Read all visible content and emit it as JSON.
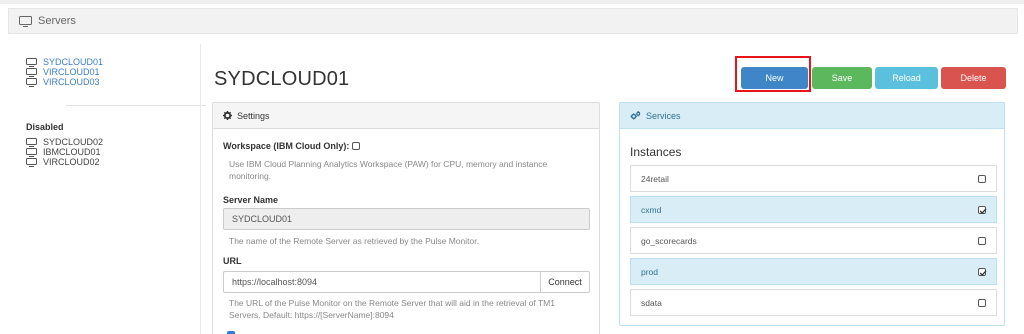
{
  "header": {
    "title": "Servers"
  },
  "sidebar": {
    "enabled_servers": [
      "SYDCLOUD01",
      "VIRCLOUD01",
      "VIRCLOUD03"
    ],
    "disabled_title": "Disabled",
    "disabled_servers": [
      "SYDCLOUD02",
      "IBMCLOUD01",
      "VIRCLOUD02"
    ]
  },
  "main": {
    "title": "SYDCLOUD01",
    "buttons": {
      "new": "New",
      "save": "Save",
      "reload": "Reload",
      "delete": "Delete"
    }
  },
  "settings": {
    "heading": "Settings",
    "workspace_label": "Workspace (IBM Cloud Only):",
    "workspace_checked": false,
    "workspace_help": "Use IBM Cloud Planning Analytics Workspace (PAW) for CPU, memory and instance monitoring.",
    "server_name_label": "Server Name",
    "server_name_value": "SYDCLOUD01",
    "server_name_help": "The name of the Remote Server as retrieved by the Pulse Monitor.",
    "url_label": "URL",
    "url_value": "https://localhost:8094",
    "connect_label": "Connect",
    "url_help": "The URL of the Pulse Monitor on the Remote Server that will aid in the retrieval of TM1 Servers. Default: https://[ServerName]:8094"
  },
  "services": {
    "heading": "Services",
    "instances_title": "Instances",
    "instances": [
      {
        "name": "24retail",
        "checked": false
      },
      {
        "name": "cxmd",
        "checked": true
      },
      {
        "name": "go_scorecards",
        "checked": false
      },
      {
        "name": "prod",
        "checked": true
      },
      {
        "name": "sdata",
        "checked": false
      }
    ]
  },
  "colors": {
    "new": "#3f86c9",
    "save": "#5cb85c",
    "reload": "#5bc0de",
    "delete": "#d9534f",
    "link": "#3a7fc4",
    "highlight": "#e8141c",
    "info_bg": "#d9edf7"
  }
}
